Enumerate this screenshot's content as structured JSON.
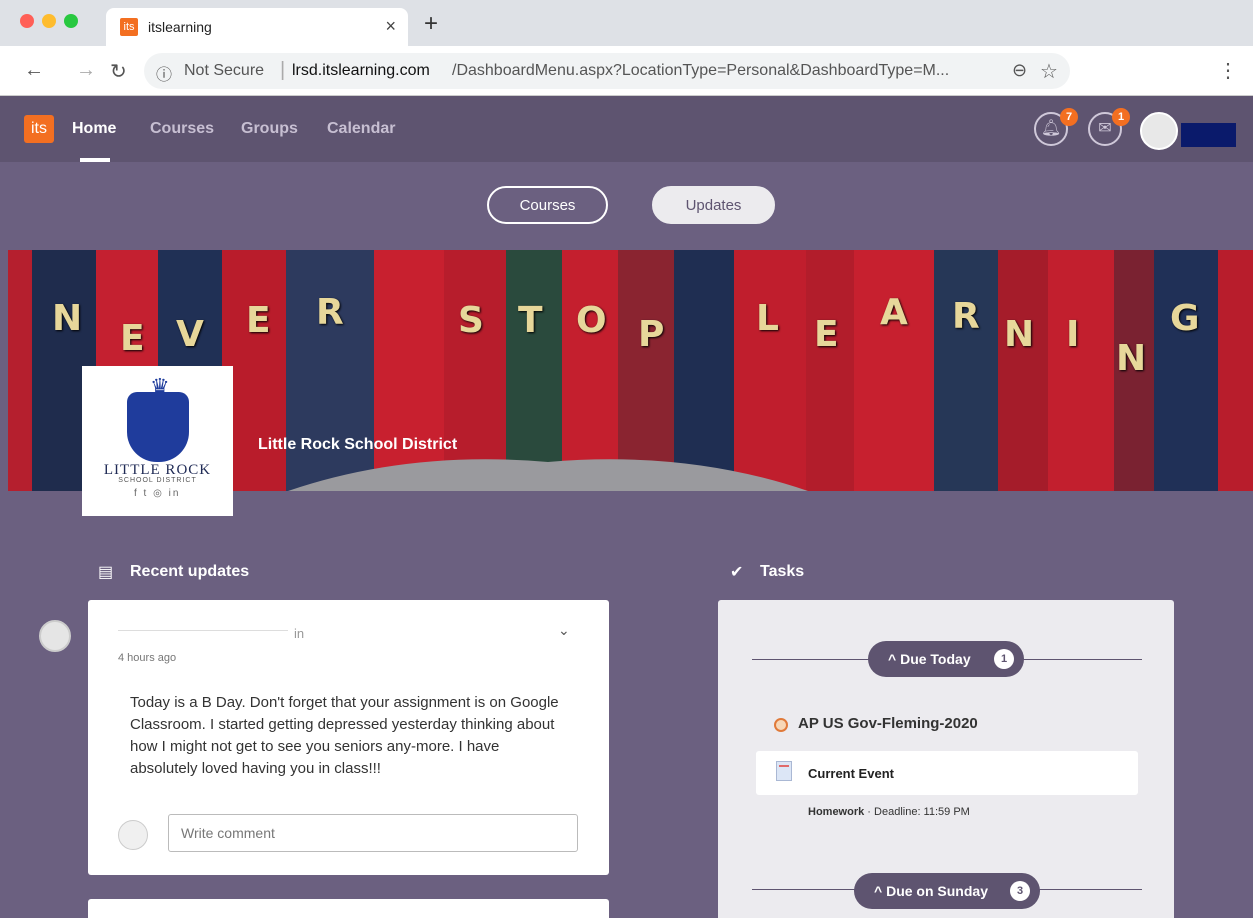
{
  "browser": {
    "tab_title": "itslearning",
    "tab_favicon": "its",
    "new_tab_label": "+",
    "url_not_secure": "Not Secure",
    "url_domain": "lrsd.itslearning.com",
    "url_path": "/DashboardMenu.aspx?LocationType=Personal&DashboardType=M...",
    "icons": [
      "back-arrow-icon",
      "forward-arrow-icon",
      "reload-icon",
      "info-icon",
      "zoom-icon",
      "bookmark-star-icon",
      "menu-dots-icon"
    ]
  },
  "header": {
    "logo": "its",
    "nav": [
      {
        "label": "Home",
        "active": true
      },
      {
        "label": "Courses",
        "active": false
      },
      {
        "label": "Groups",
        "active": false
      },
      {
        "label": "Calendar",
        "active": false
      }
    ],
    "notifications_count": "7",
    "messages_count": "1"
  },
  "toggle": {
    "courses_label": "Courses",
    "updates_label": "Updates"
  },
  "banner": {
    "letters": [
      "N",
      "E",
      "V",
      "E",
      "R",
      "S",
      "T",
      "O",
      "P",
      "L",
      "E",
      "A",
      "R",
      "N",
      "I",
      "N",
      "G"
    ],
    "district_name": "Little Rock School District",
    "logo_text": "LITTLE ROCK",
    "logo_subtext": "SCHOOL DISTRICT",
    "logo_social": "f  t  ◎  in"
  },
  "updates": {
    "title": "Recent updates",
    "post": {
      "in_label": "in",
      "time": "4 hours ago",
      "body": "Today is a B Day. Don't forget that your assignment is on Google Classroom. I started getting depressed yesterday thinking about how I might not get to see you seniors any-more. I have absolutely loved having you in class!!!",
      "comment_placeholder": "Write comment"
    }
  },
  "tasks": {
    "title": "Tasks",
    "groups": [
      {
        "label": "Due Today",
        "count": "1",
        "course": "AP US Gov-Fleming-2020",
        "item_title": "Current Event",
        "item_type": "Homework",
        "item_deadline": " · Deadline: 11:59 PM"
      },
      {
        "label": "Due on Sunday",
        "count": "3"
      }
    ]
  },
  "colors": {
    "brand_orange": "#f36f21",
    "header_purple": "#5e5470",
    "page_bg": "#6b6080"
  }
}
